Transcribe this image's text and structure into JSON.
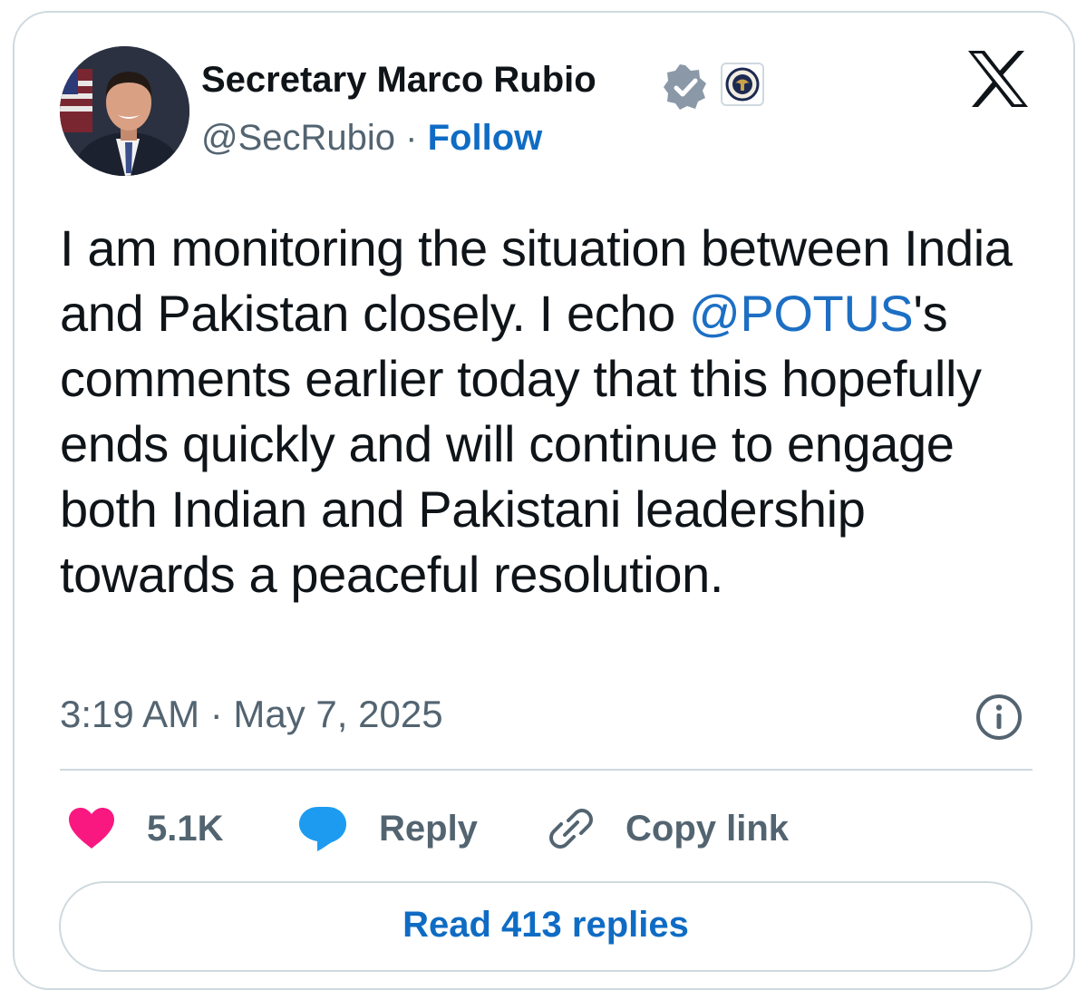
{
  "author": {
    "name": "Secretary Marco Rubio",
    "handle": "@SecRubio",
    "separator": "·",
    "follow_label": "Follow"
  },
  "tweet": {
    "text_before": "I am monitoring the situation between India and Pakistan closely. I echo ",
    "mention": "@POTUS",
    "text_after": "'s comments earlier today that this hopefully ends quickly and will continue to engage both Indian and Pakistani leadership towards a peaceful resolution.",
    "timestamp": "3:19 AM · May 7, 2025"
  },
  "actions": {
    "like_count": "5.1K",
    "reply_label": "Reply",
    "copy_label": "Copy link"
  },
  "read_replies_label": "Read 413 replies",
  "icons": {
    "platform": "x-logo-icon",
    "verified": "verified-badge-icon",
    "affiliation": "state-department-seal-icon",
    "like": "heart-icon",
    "reply": "speech-bubble-icon",
    "copy": "link-icon",
    "info": "info-icon"
  },
  "colors": {
    "link": "#1d6fc4",
    "like": "#f91880",
    "reply": "#1d9bf0",
    "secondary_text": "#536471",
    "border": "#cfd9de"
  }
}
